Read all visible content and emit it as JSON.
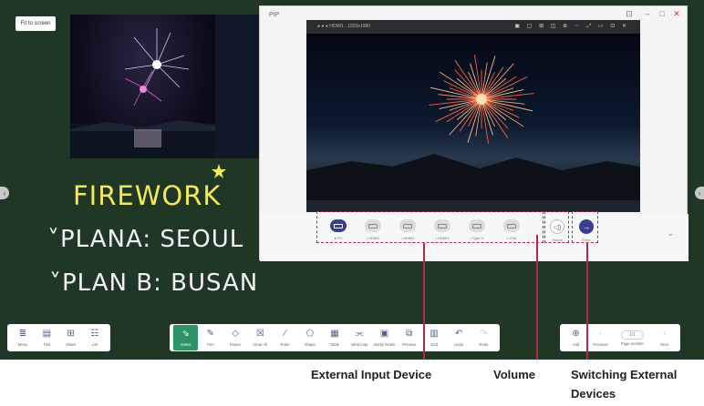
{
  "board": {
    "fit_to_screen": "Fit to screen",
    "handwriting": {
      "title": "FIREWORK",
      "line1": "˅PLANA: SEOUL",
      "line2": "˅PLAN B: BUSAN"
    },
    "colors": {
      "background": "#203726",
      "title": "#f4e95a",
      "ink": "#f2f2f2"
    }
  },
  "pip": {
    "title": "PIP",
    "video_title": "● ● ● HDMI1 · 1920x1080",
    "devices": [
      {
        "label": "● PC",
        "icon": "pc-icon",
        "active": true
      },
      {
        "label": "• HDMI1",
        "icon": "hdmi-icon",
        "active": false
      },
      {
        "label": "• HDMI2",
        "icon": "hdmi-icon",
        "active": false
      },
      {
        "label": "• HDMI3",
        "icon": "hdmi-icon",
        "active": false
      },
      {
        "label": "• Type-C",
        "icon": "type-c-icon",
        "active": false
      },
      {
        "label": "• VGA",
        "icon": "vga-icon",
        "active": false
      }
    ],
    "volume_label": "Sound",
    "switch_label": "Enter"
  },
  "toolbar": {
    "left": [
      {
        "label": "Menu",
        "icon": "menu-icon",
        "glyph": "≣"
      },
      {
        "label": "Tool",
        "icon": "tool-icon",
        "glyph": "▤"
      },
      {
        "label": "Share",
        "icon": "share-icon",
        "glyph": "⊞"
      },
      {
        "label": "List",
        "icon": "list-icon",
        "glyph": "☷"
      }
    ],
    "center": [
      {
        "label": "Select",
        "icon": "select-icon",
        "glyph": "⇘",
        "active": true
      },
      {
        "label": "Pen",
        "icon": "pen-icon",
        "glyph": "✎"
      },
      {
        "label": "Eraser",
        "icon": "eraser-icon",
        "glyph": "◇"
      },
      {
        "label": "Clear All",
        "icon": "clear-all-icon",
        "glyph": "☒"
      },
      {
        "label": "Ruler",
        "icon": "ruler-icon",
        "glyph": "∕"
      },
      {
        "label": "Shape",
        "icon": "shape-icon",
        "glyph": "⬠"
      },
      {
        "label": "Table",
        "icon": "table-icon",
        "glyph": "▦"
      },
      {
        "label": "Mind map",
        "icon": "mind-map-icon",
        "glyph": "⫘"
      },
      {
        "label": "Sticky Notes",
        "icon": "sticky-notes-icon",
        "glyph": "▣"
      },
      {
        "label": "Preview",
        "icon": "preview-icon",
        "glyph": "⧉"
      },
      {
        "label": "Grid",
        "icon": "grid-icon",
        "glyph": "▥"
      },
      {
        "label": "Undo",
        "icon": "undo-icon",
        "glyph": "↶"
      },
      {
        "label": "Redo",
        "icon": "redo-icon",
        "glyph": "↷",
        "dim": true
      }
    ],
    "right": {
      "add": "Add",
      "previous": "Previous",
      "page_number_value": "1/1",
      "page_number": "Page number",
      "next": "Next"
    }
  },
  "callouts": {
    "external_input": "External Input Device",
    "volume": "Volume",
    "switching": "Switching External",
    "switching_2": "Devices"
  },
  "accent": "#b22846"
}
